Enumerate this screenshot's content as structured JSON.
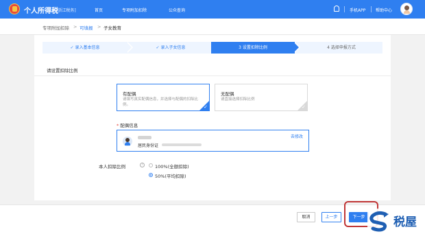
{
  "header": {
    "title": "个人所得税",
    "region": "[浙江税务]",
    "nav": [
      "首页",
      "专项附加扣除",
      "公众查询"
    ],
    "mobile_app": "手机APP",
    "help_center": "帮助中心"
  },
  "breadcrumb": {
    "items": [
      "专项附加扣除",
      "可填报",
      "子女教育"
    ],
    "separator": ">"
  },
  "steps": [
    {
      "label": "✓ 录入基本信息",
      "state": "done"
    },
    {
      "label": "✓ 录入子女信息",
      "state": "done"
    },
    {
      "label": "3 设置扣除比例",
      "state": "active"
    },
    {
      "label": "4 选择申报方式",
      "state": "todo"
    }
  ],
  "section": {
    "title": "请设置扣除比例"
  },
  "options": [
    {
      "title": "有配偶",
      "desc": "请填写真实配偶信息，并选择与配偶的扣除比例。",
      "selected": true
    },
    {
      "title": "无配偶",
      "desc": "请直接选择扣除比例",
      "selected": false
    }
  ],
  "spouse": {
    "label": "配偶信息",
    "required_mark": "*",
    "id_type": "居民身份证",
    "change_link": "去修改"
  },
  "ratio": {
    "label": "本人扣除比例",
    "help_icon": "?",
    "options": [
      {
        "label": "100%(全额扣除)",
        "selected": false
      },
      {
        "label": "50%(平均扣除)",
        "selected": true
      }
    ]
  },
  "footer": {
    "cancel": "取消",
    "prev": "上一步",
    "next": "下一步"
  },
  "watermark": {
    "text": "税屋"
  },
  "colors": {
    "primary": "#2f7ff0",
    "highlight": "#c03535",
    "watermark": "#1f5fb3"
  }
}
